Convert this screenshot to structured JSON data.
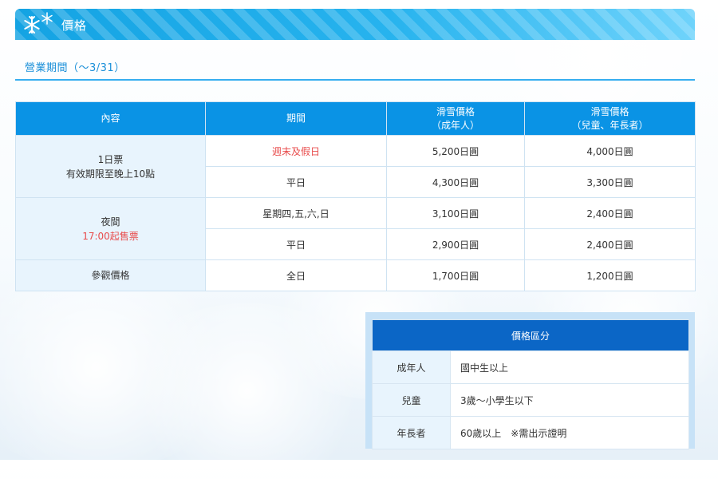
{
  "section": {
    "title": "價格",
    "icon": "snowflake-icon"
  },
  "season": {
    "label": "營業期間（～3/31）"
  },
  "price_table": {
    "headers": {
      "content": "內容",
      "period": "期間",
      "adult_line1": "滑雪價格",
      "adult_line2": "（成年人）",
      "child_line1": "滑雪價格",
      "child_line2": "（兒童、年長者）"
    },
    "groups": [
      {
        "name_line1": "1日票",
        "name_line2": "有效期限至晚上10點",
        "rows": [
          {
            "period": "週末及假日",
            "adult": "5,200日圓",
            "child": "4,000日圓"
          },
          {
            "period": "平日",
            "adult": "4,300日圓",
            "child": "3,300日圓"
          }
        ]
      },
      {
        "name_line1": "夜間",
        "name_line2": "17:00起售票",
        "rows": [
          {
            "period": "星期四,五,六,日",
            "adult": "3,100日圓",
            "child": "2,400日圓"
          },
          {
            "period": "平日",
            "adult": "2,900日圓",
            "child": "2,400日圓"
          }
        ]
      },
      {
        "name_line1": "參觀價格",
        "rows": [
          {
            "period": "全日",
            "adult": "1,700日圓",
            "child": "1,200日圓"
          }
        ]
      }
    ]
  },
  "classification": {
    "title": "價格區分",
    "rows": [
      {
        "label": "成年人",
        "value": "國中生以上"
      },
      {
        "label": "兒童",
        "value": "3歲～小學生以下"
      },
      {
        "label": "年長者",
        "value": "60歲以上　※需出示證明"
      }
    ]
  },
  "colors": {
    "header_blue": "#14a3e3",
    "table_header_blue": "#0a93e5",
    "class_header_blue": "#0b66c6",
    "accent_red": "#e84b4b",
    "light_cell": "#e8f4fd"
  }
}
